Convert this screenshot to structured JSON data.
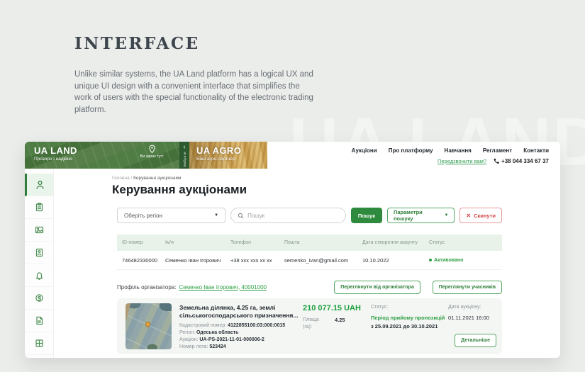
{
  "page": {
    "heading": "INTERFACE",
    "description": "Unlike similar systems, the UA Land platform has a logical UX and unique UI design with a convenient interface that simplifies the work of users with the special functionality of the electronic trading platform.",
    "watermark": "UA LAND"
  },
  "header": {
    "brand_left": {
      "title": "UA LAND",
      "tagline": "Прозоро і надійно"
    },
    "location": {
      "label": "Ви зараз тут!",
      "icon": "location-pin-icon"
    },
    "switcher": {
      "chevron": "‹",
      "vertical_label": "Вибрати"
    },
    "brand_right": {
      "title": "UA AGRO",
      "tagline": "Ваш агро-партнер"
    },
    "nav": [
      {
        "label": "Аукціони"
      },
      {
        "label": "Про платформу"
      },
      {
        "label": "Навчання"
      },
      {
        "label": "Регламент"
      },
      {
        "label": "Контакти"
      }
    ],
    "callback_link": "Передзвонити вам?",
    "phone": "+38 044 334 67 37"
  },
  "sidebar": {
    "items": [
      {
        "icon": "user-icon",
        "active": true
      },
      {
        "icon": "clipboard-icon",
        "active": false
      },
      {
        "icon": "image-card-icon",
        "active": false
      },
      {
        "icon": "contact-book-icon",
        "active": false
      },
      {
        "icon": "bell-icon",
        "active": false
      },
      {
        "icon": "coin-icon",
        "active": false
      },
      {
        "icon": "document-icon",
        "active": false
      },
      {
        "icon": "grid-icon",
        "active": false
      }
    ]
  },
  "breadcrumb": {
    "home": "Головна",
    "separator": " / ",
    "current": "Керування аукціонами"
  },
  "main": {
    "title": "Керування аукціонами",
    "filters": {
      "region_select": "Оберіть регіон",
      "search_placeholder": "Пошук",
      "search_button": "Пошук",
      "params_button": "Параметри пошуку",
      "reset_button": "Скинути"
    },
    "table": {
      "columns": [
        "ID-номер",
        "Ім'я",
        "Телефон",
        "Пошта",
        "Дата створення акаунту",
        "Статус"
      ],
      "rows": [
        {
          "id": "746482330000",
          "name": "Семенко Іван Ігорович",
          "phone": "+38 xxx xxx xx xx",
          "email": "semenko_ivan@gmail.com",
          "created": "10.10.2022",
          "status": "Активовано"
        }
      ]
    },
    "profile": {
      "label": "Профіль організатора:",
      "link": "Семенко Іван Ігорович, 40001000",
      "view_organizer_button": "Переглянути від організатора",
      "view_participants_button": "Переглянути учасників"
    },
    "auction_card": {
      "title": "Земельна ділянка, 4.25 га, землі сільськогосподарського призначення...",
      "fields": [
        {
          "label": "Кадастровий номер: ",
          "value": "4122855100:03:000:0015"
        },
        {
          "label": "Регіон: ",
          "value": "Одеська область"
        },
        {
          "label": "Аукціон: ",
          "value": "UA-PS-2021-11-01-000006-2"
        },
        {
          "label": "Номер лота: ",
          "value": "523424"
        }
      ],
      "price": "210 077.15 UAH",
      "area_label_1": "Площа",
      "area_label_2": "(га):",
      "area_value": "4.25",
      "status_label": "Статус:",
      "status_value": "Період прийому пропозицій",
      "status_period": "з 25.09.2021 до 30.10.2021",
      "date_label": "Дата аукціону:",
      "date_value": "01.11.2021 16:00",
      "details_button": "Детальніше"
    }
  },
  "colors": {
    "accent_green": "#2e8b3d",
    "link_green": "#2f9e44",
    "table_header_green": "#e8f2e9",
    "danger_red": "#d64545",
    "page_background": "#ebedeb"
  }
}
